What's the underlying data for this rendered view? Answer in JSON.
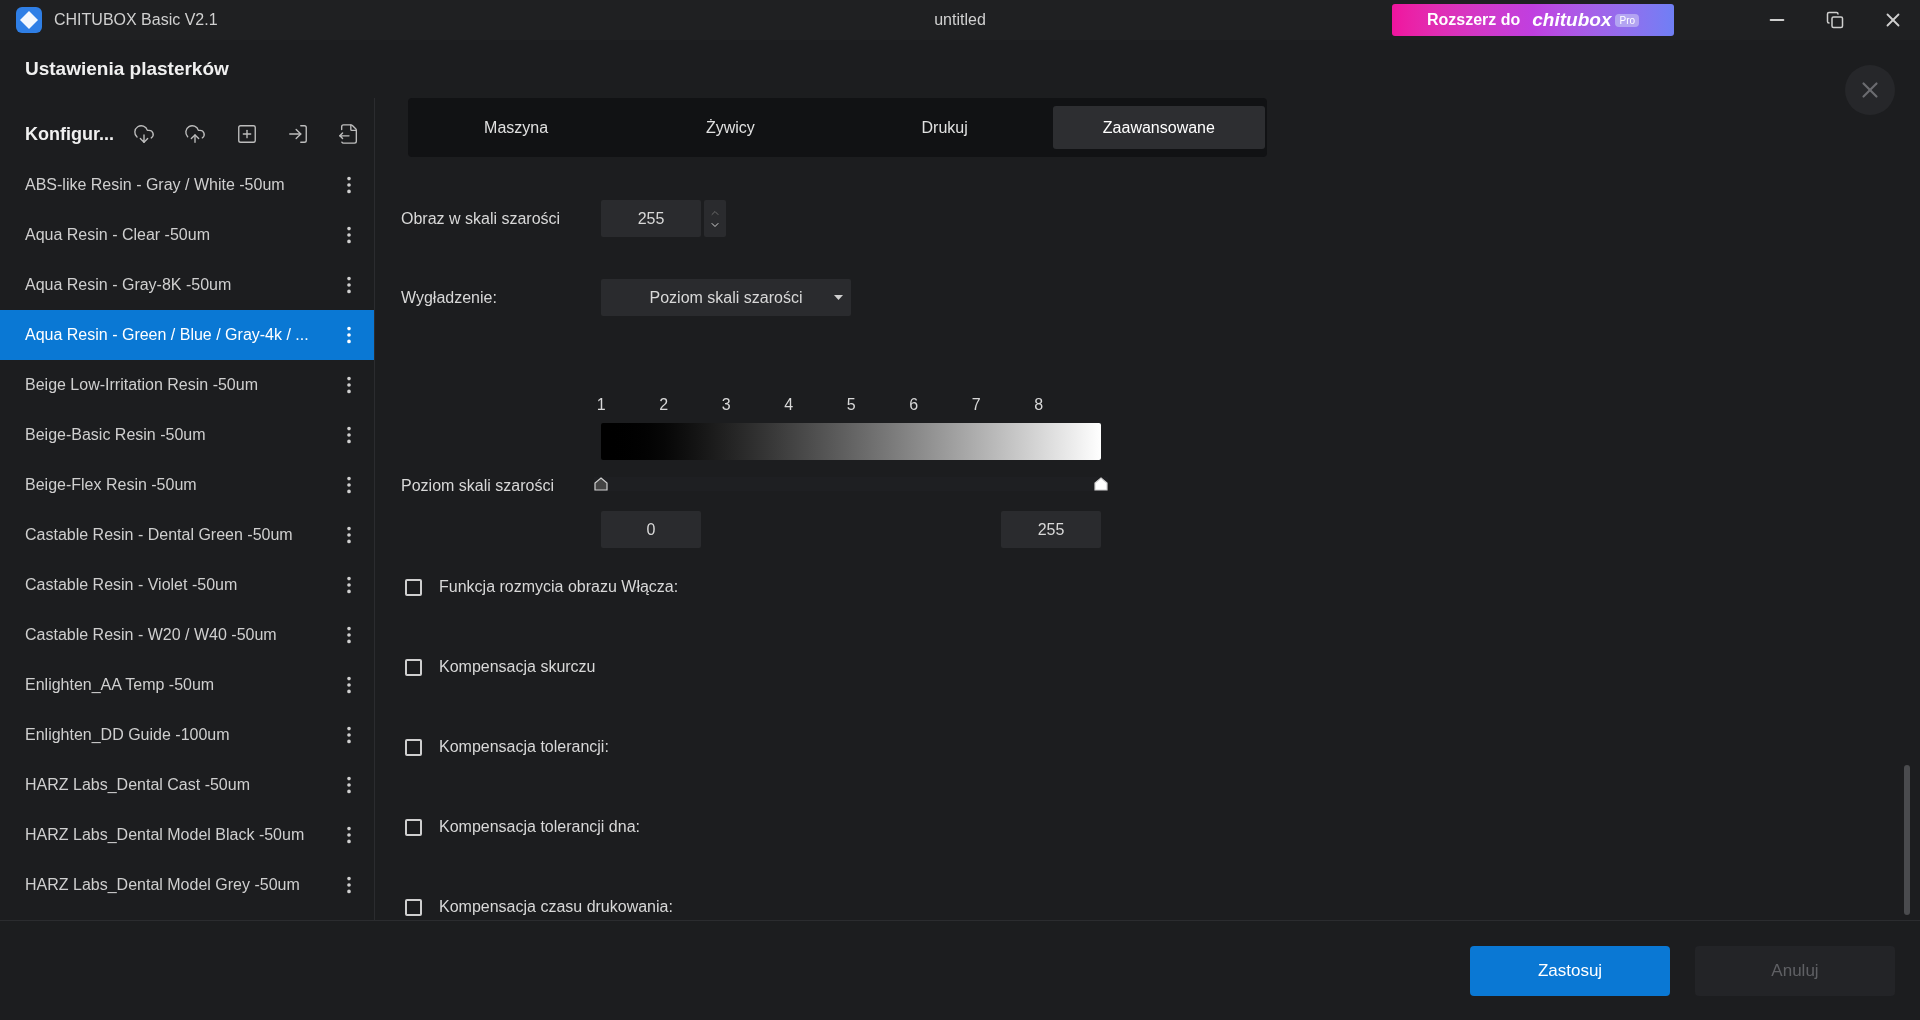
{
  "window": {
    "title": "CHITUBOX Basic V2.1",
    "document": "untitled",
    "upgrade": {
      "label": "Rozszerz do",
      "brand": "chitubox",
      "badge": "Pro"
    }
  },
  "dialog": {
    "title": "Ustawienia plasterków"
  },
  "sidebar": {
    "title": "Konfigur...",
    "items": [
      {
        "label": "ABS-like Resin - Gray / White -50um",
        "selected": false
      },
      {
        "label": "Aqua Resin - Clear -50um",
        "selected": false
      },
      {
        "label": "Aqua Resin - Gray-8K -50um",
        "selected": false
      },
      {
        "label": "Aqua Resin - Green / Blue / Gray-4k / ...",
        "selected": true
      },
      {
        "label": "Beige Low-Irritation Resin -50um",
        "selected": false
      },
      {
        "label": "Beige-Basic Resin -50um",
        "selected": false
      },
      {
        "label": "Beige-Flex Resin -50um",
        "selected": false
      },
      {
        "label": "Castable Resin - Dental Green -50um",
        "selected": false
      },
      {
        "label": "Castable Resin - Violet -50um",
        "selected": false
      },
      {
        "label": "Castable Resin - W20 / W40 -50um",
        "selected": false
      },
      {
        "label": "Enlighten_AA Temp -50um",
        "selected": false
      },
      {
        "label": "Enlighten_DD Guide -100um",
        "selected": false
      },
      {
        "label": "HARZ Labs_Dental Cast -50um",
        "selected": false
      },
      {
        "label": "HARZ Labs_Dental Model Black -50um",
        "selected": false
      },
      {
        "label": "HARZ Labs_Dental Model Grey -50um",
        "selected": false
      }
    ]
  },
  "tabs": [
    {
      "label": "Maszyna",
      "selected": false
    },
    {
      "label": "Żywicy",
      "selected": false
    },
    {
      "label": "Drukuj",
      "selected": false
    },
    {
      "label": "Zaawansowane",
      "selected": true
    }
  ],
  "settings": {
    "grayscale_image": {
      "label": "Obraz w skali szarości",
      "value": "255"
    },
    "smoothing": {
      "label": "Wygładzenie:",
      "value": "Poziom skali szarości"
    },
    "gray_level": {
      "label": "Poziom skali szarości",
      "ticks": [
        "1",
        "2",
        "3",
        "4",
        "5",
        "6",
        "7",
        "8"
      ],
      "handles": [
        {
          "level": 0
        },
        {
          "level": 1
        }
      ],
      "min": "0",
      "max": "255"
    },
    "options": [
      {
        "label": "Funkcja rozmycia obrazu Włącza:",
        "checked": false
      },
      {
        "label": "Kompensacja skurczu",
        "checked": false
      },
      {
        "label": "Kompensacja tolerancji:",
        "checked": false
      },
      {
        "label": "Kompensacja tolerancji dna:",
        "checked": false
      },
      {
        "label": "Kompensacja czasu drukowania:",
        "checked": false
      }
    ]
  },
  "buttons": [
    {
      "label": "Zastosuj",
      "kind": "primary",
      "disabled": false
    },
    {
      "label": "Anuluj",
      "kind": "secondary",
      "disabled": true
    }
  ]
}
